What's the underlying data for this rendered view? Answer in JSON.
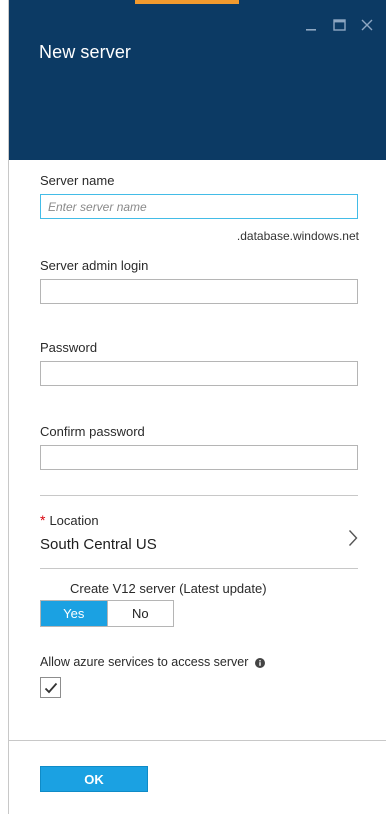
{
  "header": {
    "title": "New server",
    "colors": {
      "background": "#0c3a64",
      "accent": "#f29a2e"
    },
    "window_controls": [
      {
        "icon": "minimize-icon"
      },
      {
        "icon": "maximize-icon"
      },
      {
        "icon": "close-icon"
      }
    ]
  },
  "form": {
    "server_name": {
      "label": "Server name",
      "value": "",
      "placeholder": "Enter server name",
      "suffix": ".database.windows.net"
    },
    "admin_login": {
      "label": "Server admin login",
      "value": ""
    },
    "password": {
      "label": "Password",
      "value": ""
    },
    "confirm_password": {
      "label": "Confirm password",
      "value": ""
    },
    "location": {
      "required_marker": "*",
      "label": "Location",
      "value": "South Central US",
      "icon": "chevron-right-icon"
    },
    "v12": {
      "label": "Create V12 server (Latest update)",
      "options": [
        "Yes",
        "No"
      ],
      "selected": "Yes"
    },
    "allow_azure": {
      "label": "Allow azure services to access server",
      "info_icon": "info-icon",
      "checked": true
    }
  },
  "footer": {
    "ok_label": "OK"
  },
  "colors": {
    "primary_button": "#1ba1e2",
    "focus_border": "#43bce7",
    "required": "#d9000b"
  }
}
